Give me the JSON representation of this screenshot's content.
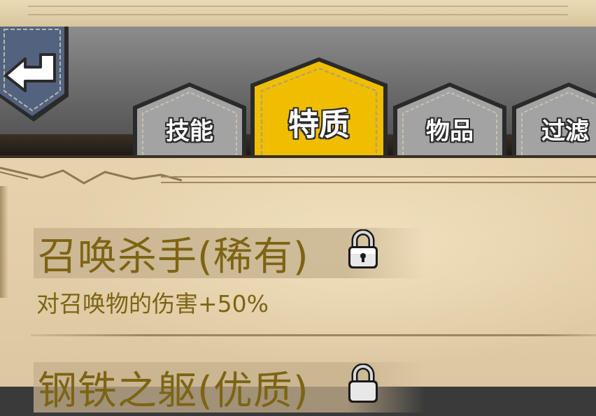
{
  "tabs": {
    "skills": "技能",
    "traits": "特质",
    "items": "物品",
    "filter": "过滤"
  },
  "active_tab": "traits",
  "traits": [
    {
      "name": "召唤杀手(稀有)",
      "description": "对召唤物的伤害+50%",
      "locked": true
    },
    {
      "name": "钢铁之躯(优质)",
      "description": "",
      "locked": true
    }
  ],
  "colors": {
    "active_tab": "#f0be00",
    "inactive_tab": "#a3a3a3",
    "trait_text": "#7d6414",
    "parchment": "#e6d3ad",
    "banner": "#4f5f7d"
  },
  "icons": {
    "back": "back-arrow-icon",
    "lock": "padlock-icon"
  }
}
